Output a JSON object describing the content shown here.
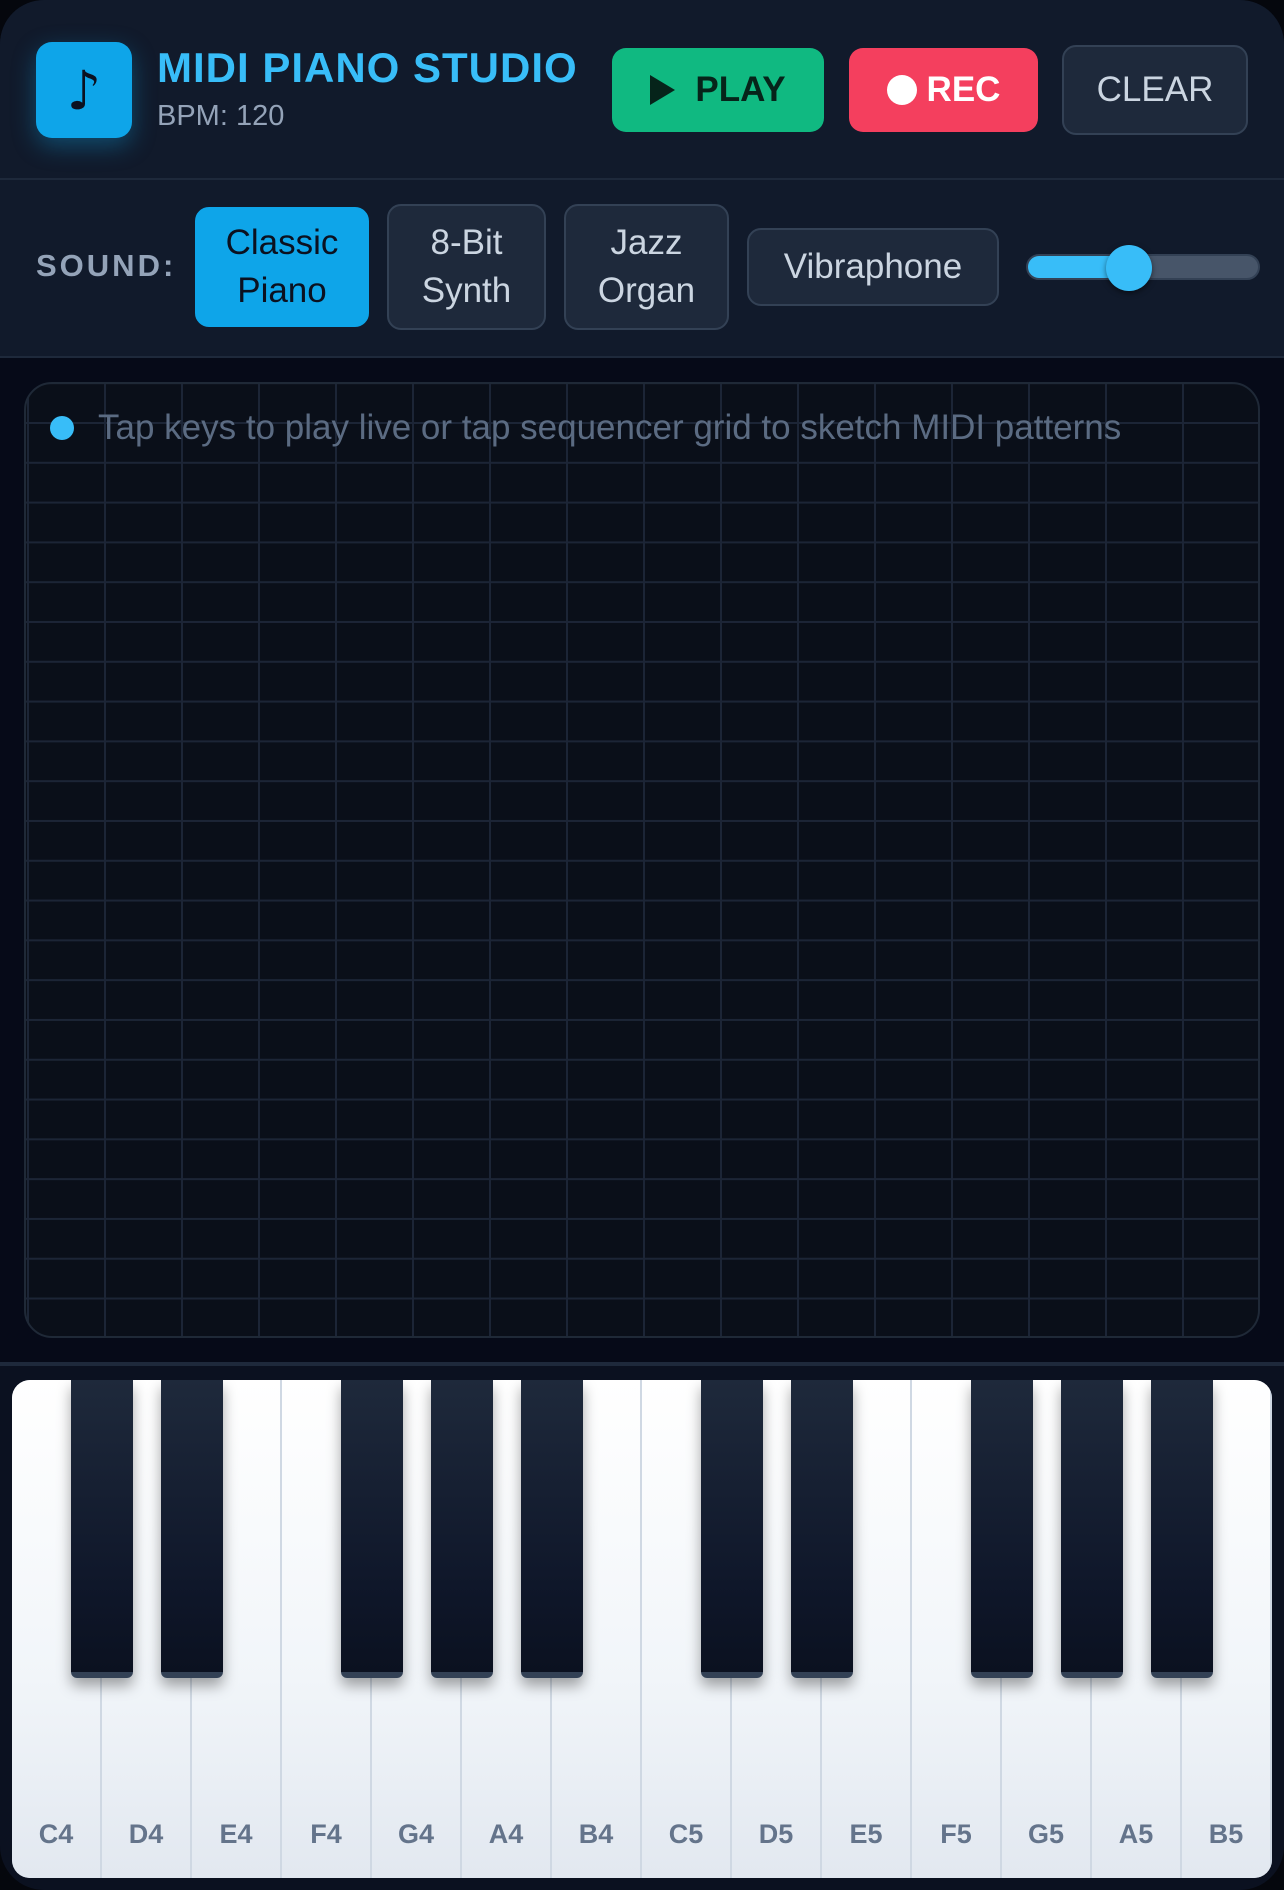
{
  "app": {
    "icon": "music-note-icon",
    "icon_glyph": "♪",
    "title": "MIDI PIANO STUDIO",
    "bpm_text": "BPM: 120"
  },
  "transport": {
    "play_label": "PLAY",
    "rec_label": "REC",
    "clear_label": "CLEAR"
  },
  "sound": {
    "label": "SOUND:",
    "presets": [
      {
        "line1": "Classic",
        "line2": "Piano",
        "active": true
      },
      {
        "line1": "8-Bit",
        "line2": "Synth",
        "active": false
      },
      {
        "line1": "Jazz",
        "line2": "Organ",
        "active": false
      },
      {
        "line1": "Vibraphone",
        "line2": "",
        "active": false
      }
    ],
    "volume_fraction": 0.44
  },
  "sequencer": {
    "hint": "Tap keys to play live or tap sequencer grid to sketch MIDI patterns"
  },
  "keyboard": {
    "white_keys": [
      "C4",
      "D4",
      "E4",
      "F4",
      "G4",
      "A4",
      "B4",
      "C5",
      "D5",
      "E5",
      "F5",
      "G5",
      "A5",
      "B5"
    ]
  },
  "colors": {
    "accent": "#0ea5e9",
    "title": "#38bdf8",
    "play": "#10b981",
    "rec": "#f43f5e",
    "background": "#0b1120"
  }
}
